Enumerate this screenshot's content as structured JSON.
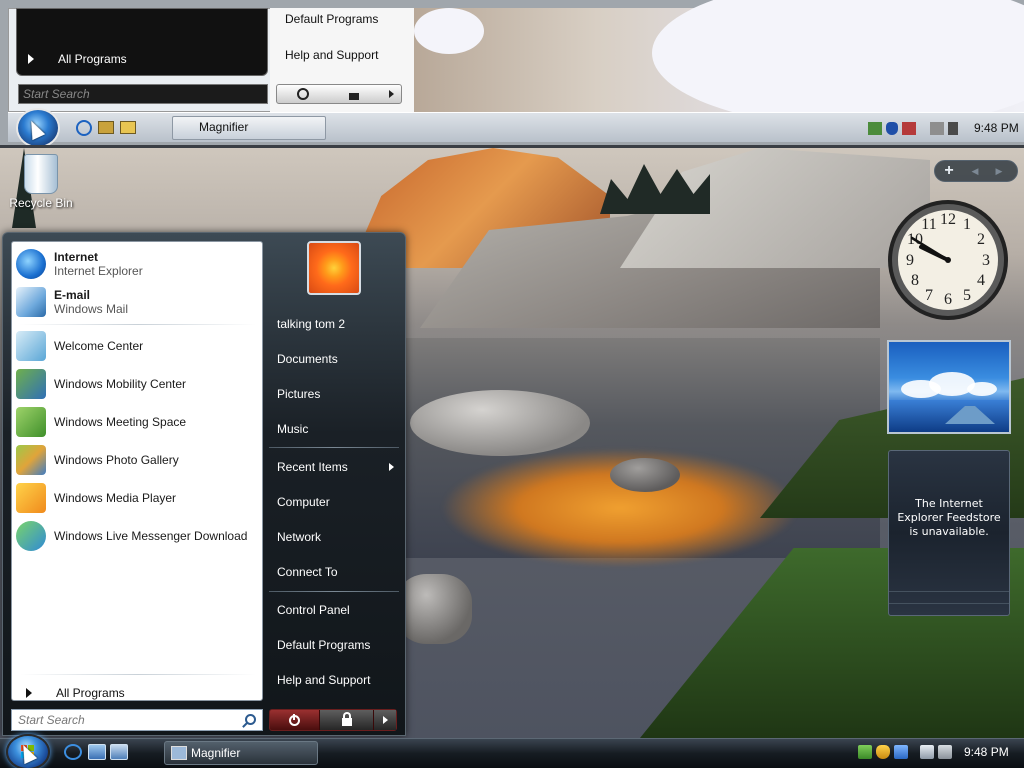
{
  "magnifier": {
    "links": [
      "Default Programs",
      "Help and Support"
    ],
    "all_programs": "All Programs",
    "search_placeholder": "Start Search",
    "task_button": "Magnifier",
    "clock": "9:48 PM"
  },
  "desktop": {
    "recycle_bin_label": "Recycle Bin"
  },
  "start_menu": {
    "pinned": [
      {
        "name": "Internet",
        "sub": "Internet Explorer",
        "icon": "internet-explorer-icon"
      },
      {
        "name": "E-mail",
        "sub": "Windows Mail",
        "icon": "windows-mail-icon"
      }
    ],
    "recent": [
      {
        "name": "Welcome Center",
        "icon": "welcome-center-icon"
      },
      {
        "name": "Windows Mobility Center",
        "icon": "mobility-center-icon"
      },
      {
        "name": "Windows Meeting Space",
        "icon": "meeting-space-icon"
      },
      {
        "name": "Windows Photo Gallery",
        "icon": "photo-gallery-icon"
      },
      {
        "name": "Windows Media Player",
        "icon": "media-player-icon"
      },
      {
        "name": "Windows Live Messenger Download",
        "icon": "messenger-icon"
      }
    ],
    "all_programs": "All Programs",
    "search_placeholder": "Start Search",
    "right_links": {
      "user": "talking tom 2",
      "documents": "Documents",
      "pictures": "Pictures",
      "music": "Music",
      "recent_items": "Recent Items",
      "computer": "Computer",
      "network": "Network",
      "connect_to": "Connect To",
      "control_panel": "Control Panel",
      "default_programs": "Default Programs",
      "help_support": "Help and Support"
    }
  },
  "sidebar": {
    "add_label": "+",
    "feed_message": "The Internet Explorer Feedstore is unavailable."
  },
  "clock_gadget": {
    "numbers": [
      "12",
      "1",
      "2",
      "3",
      "4",
      "5",
      "6",
      "7",
      "8",
      "9",
      "10",
      "11"
    ]
  },
  "taskbar": {
    "task_button": "Magnifier",
    "clock": "9:48 PM"
  },
  "colors": {
    "accent": "#1b4c9a",
    "taskbar": "#161c22",
    "power_button": "#9a3030"
  }
}
